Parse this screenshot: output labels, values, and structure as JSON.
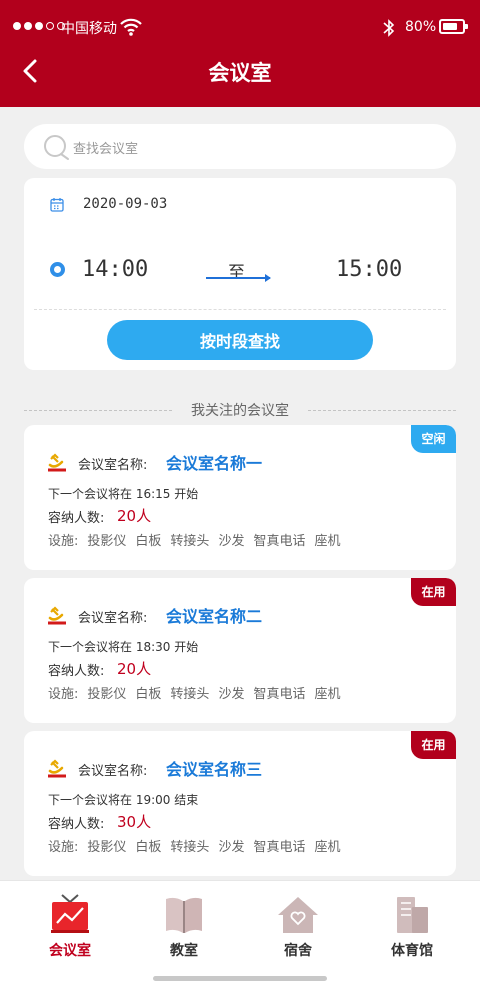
{
  "status_bar": {
    "carrier": "中国移动",
    "battery_pct": "80%",
    "battery_level": 0.8
  },
  "header": {
    "title": "会议室"
  },
  "search": {
    "placeholder": "查找会议室"
  },
  "time_picker": {
    "date": "2020-09-03",
    "start_time": "14:00",
    "to_label": "至",
    "end_time": "15:00",
    "find_button": "按时段查找"
  },
  "favorites_title": "我关注的会议室",
  "rooms": [
    {
      "name_key": "会议室名称:",
      "name": "会议室名称一",
      "next_meeting": "下一个会议将在 16:15 开始",
      "capacity_key": "容纳人数:",
      "capacity": "20人",
      "facilities_key": "设施:",
      "facilities": [
        "投影仪",
        "白板",
        "转接头",
        "沙发",
        "智真电话",
        "座机"
      ],
      "status": "空闲"
    },
    {
      "name_key": "会议室名称:",
      "name": "会议室名称二",
      "next_meeting": "下一个会议将在 18:30 开始",
      "capacity_key": "容纳人数:",
      "capacity": "20人",
      "facilities_key": "设施:",
      "facilities": [
        "投影仪",
        "白板",
        "转接头",
        "沙发",
        "智真电话",
        "座机"
      ],
      "status": "在用"
    },
    {
      "name_key": "会议室名称:",
      "name": "会议室名称三",
      "next_meeting": "下一个会议将在 19:00 结束",
      "capacity_key": "容纳人数:",
      "capacity": "30人",
      "facilities_key": "设施:",
      "facilities": [
        "投影仪",
        "白板",
        "转接头",
        "沙发",
        "智真电话",
        "座机"
      ],
      "status": "在用"
    }
  ],
  "tabbar": [
    {
      "label": "会议室",
      "icon": "meeting-room-icon",
      "active": true
    },
    {
      "label": "教室",
      "icon": "classroom-book-icon",
      "active": false
    },
    {
      "label": "宿舍",
      "icon": "dormitory-house-icon",
      "active": false
    },
    {
      "label": "体育馆",
      "icon": "gymnasium-building-icon",
      "active": false
    }
  ],
  "colors": {
    "brand_red": "#b2001c",
    "accent_blue": "#2eaaf0",
    "link_blue": "#1a7ad8",
    "capacity_red": "#c0001e"
  }
}
